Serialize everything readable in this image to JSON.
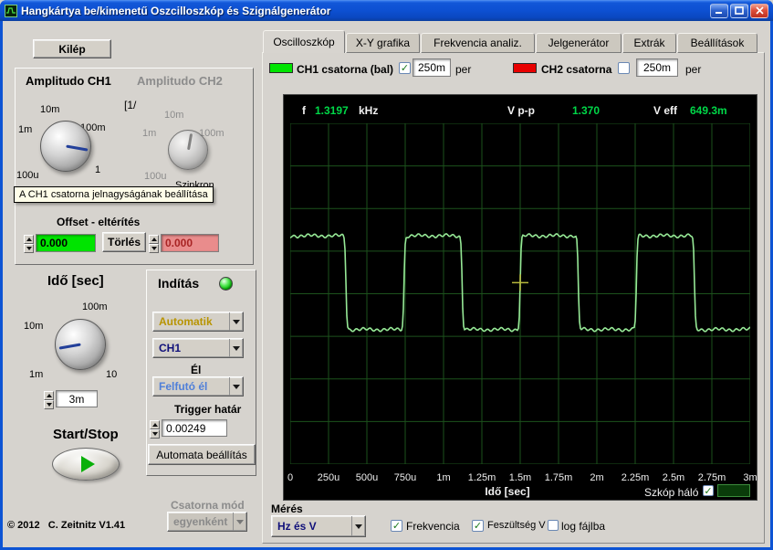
{
  "colors": {
    "ch1": "#00e400",
    "ch2": "#e80000",
    "trace": "#96e896",
    "readout": "#00d848",
    "grid": "#1c521c",
    "grid_swatch": "#0a3c0a"
  },
  "window": {
    "title": "Hangkártya be/kimenetű Oszcilloszkóp és Szignálgenerátor"
  },
  "left": {
    "exit_button": "Kilép",
    "amplitude": {
      "ch1_label": "Amplitudo CH1",
      "ch2_label": "Amplitudo CH2",
      "unit_prefix": "[1/",
      "ch1_scale": {
        "top": "10m",
        "left": "1m",
        "right": "100m",
        "bottom_left": "100u",
        "bottom_right": "1"
      },
      "ch2_scale": {
        "top": "10m",
        "left": "1m",
        "right": "100m",
        "bottom_left": "100u"
      },
      "sync_label": "Szinkron",
      "tooltip": "A CH1 csatorna jelnagyságának beállítása"
    },
    "offset": {
      "label": "Offset - eltérítés",
      "ch1_value": "0.000",
      "clear_button": "Törlés",
      "ch2_value": "0.000"
    },
    "time": {
      "label": "Idő [sec]",
      "scale": {
        "top": "100m",
        "left": "10m",
        "bottom_left": "1m",
        "bottom_right": "10"
      },
      "value": "3m"
    },
    "startstop_label": "Start/Stop",
    "copyright": "© 2012   C. Zeitnitz V1.41",
    "channel_mode_label": "Csatorna mód",
    "channel_mode_value": "egyenként"
  },
  "trigger": {
    "title": "Indítás",
    "mode_value": "Automatik",
    "source_value": "CH1",
    "edge_label": "Él",
    "edge_value": "Felfutó él",
    "threshold_label": "Trigger határ",
    "threshold_value": "0.00249",
    "auto_button": "Automata beállítás"
  },
  "tabs": [
    {
      "label": "Oscilloszkóp"
    },
    {
      "label": "X-Y grafika"
    },
    {
      "label": "Frekvencia analiz."
    },
    {
      "label": "Jelgenerátor"
    },
    {
      "label": "Extrák"
    },
    {
      "label": "Beállítások"
    }
  ],
  "channels": {
    "ch1": {
      "label": "CH1 csatorna (bal)",
      "checked": "✓",
      "per_value": "250m",
      "per_label": "per"
    },
    "ch2": {
      "label": "CH2 csatorna",
      "checked": "",
      "per_value": "250m",
      "per_label": "per"
    }
  },
  "scope": {
    "readouts": {
      "f_label": "f",
      "f_value": "1.3197",
      "f_unit": "kHz",
      "vpp_label": "V p-p",
      "vpp_value": "1.370",
      "veff_label": "V eff",
      "veff_value": "649.3m"
    },
    "x_ticks": [
      "0",
      "250u",
      "500u",
      "750u",
      "1m",
      "1.25m",
      "1.5m",
      "1.75m",
      "2m",
      "2.25m",
      "2.5m",
      "2.75m",
      "3m"
    ],
    "x_axis_label": "Idő [sec]",
    "grid_toggle_label": "Szkóp háló",
    "grid_checked": "✓",
    "waveform": {
      "type": "square",
      "freq_khz": 1.3197,
      "span_ms": 3,
      "high_frac": 0.33,
      "low_frac": 0.605,
      "trigger_frac": 0.5
    }
  },
  "bottom": {
    "meres_label": "Mérés",
    "unit_value": "Hz és V",
    "freq_label": "Frekvencia",
    "freq_checked": "✓",
    "volt_label": "Feszültség V",
    "volt_checked": "✓",
    "log_label": "log fájlba",
    "log_checked": ""
  }
}
